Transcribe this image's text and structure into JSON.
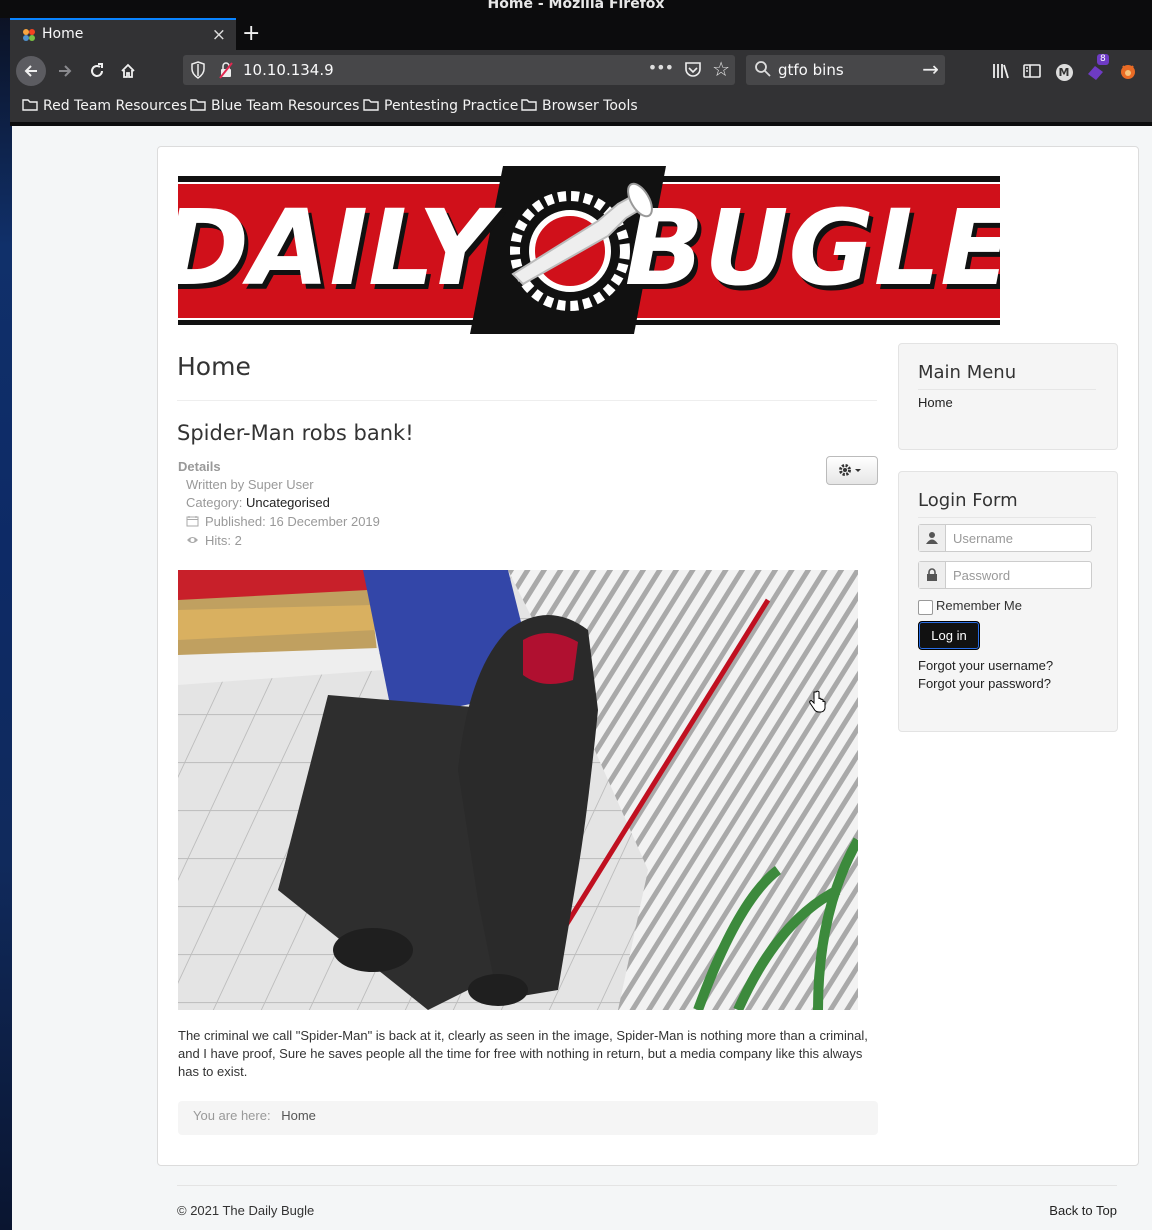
{
  "window": {
    "title": "Home - Mozilla Firefox"
  },
  "tab": {
    "label": "Home",
    "close": "×",
    "new_tab": "+"
  },
  "navbar": {
    "url": "10.10.134.9",
    "more": "•••",
    "search_value": "gtfo bins",
    "extension_badge": "8",
    "account_letter": "M"
  },
  "bookmarks": [
    {
      "label": "Red Team Resources"
    },
    {
      "label": "Blue Team Resources"
    },
    {
      "label": "Pentesting Practice"
    },
    {
      "label": "Browser Tools"
    }
  ],
  "logo": {
    "left_word": "DAILY",
    "right_word": "BUGLE",
    "colors": {
      "red": "#d0101a",
      "black": "#111111"
    }
  },
  "page": {
    "heading": "Home",
    "article": {
      "title": "Spider-Man robs bank!",
      "details_label": "Details",
      "author": "Written by Super User",
      "category_label": "Category: ",
      "category_value": "Uncategorised",
      "published": "Published: 16 December 2019",
      "hits": "Hits: 2",
      "body": "The criminal we call \"Spider-Man\" is back at it, clearly as seen in the image, Spider-Man is nothing more than a criminal, and I have proof, Sure he saves people all the time for free with nothing in return, but a media company like this always has to exist."
    },
    "breadcrumb": {
      "label": "You are here:",
      "current": "Home"
    }
  },
  "sidebar": {
    "main_menu": {
      "title": "Main Menu",
      "items": [
        "Home"
      ]
    },
    "login": {
      "title": "Login Form",
      "username_placeholder": "Username",
      "password_placeholder": "Password",
      "remember": "Remember Me",
      "button": "Log in",
      "forgot_username": "Forgot your username?",
      "forgot_password": "Forgot your password?"
    }
  },
  "footer": {
    "copyright": "© 2021 The Daily Bugle",
    "back_to_top": "Back to Top"
  }
}
